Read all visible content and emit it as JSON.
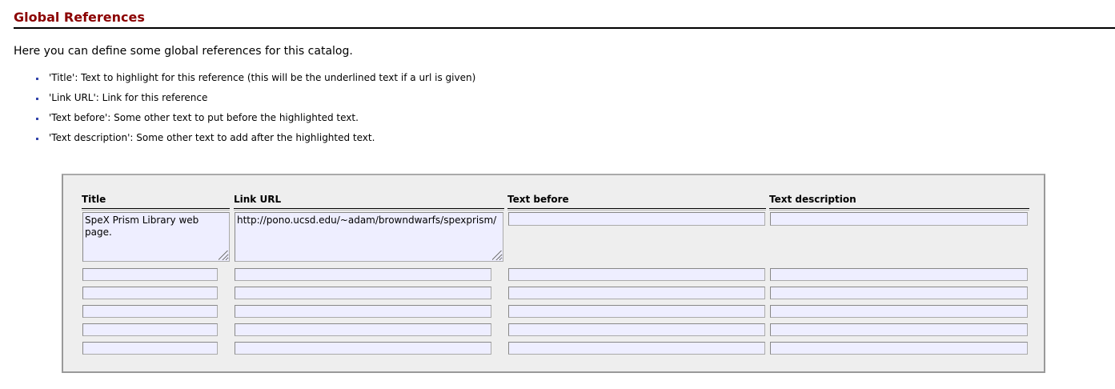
{
  "page": {
    "title": "Global References",
    "intro": "Here you can define some global references for this catalog."
  },
  "help_items": [
    "'Title': Text to highlight for this reference (this will be the underlined text if a url is given)",
    "'Link URL': Link for this reference",
    "'Text before': Some other text to put before the highlighted text.",
    "'Text description': Some other text to add after the highlighted text."
  ],
  "columns": {
    "title": "Title",
    "link_url": "Link URL",
    "text_before": "Text before",
    "text_description": "Text description"
  },
  "rows": [
    {
      "title": "SpeX Prism Library web page.",
      "link_url": "http://pono.ucsd.edu/~adam/browndwarfs/spexprism/",
      "text_before": "",
      "text_description": ""
    },
    {
      "title": "",
      "link_url": "",
      "text_before": "",
      "text_description": ""
    },
    {
      "title": "",
      "link_url": "",
      "text_before": "",
      "text_description": ""
    },
    {
      "title": "",
      "link_url": "",
      "text_before": "",
      "text_description": ""
    },
    {
      "title": "",
      "link_url": "",
      "text_before": "",
      "text_description": ""
    },
    {
      "title": "",
      "link_url": "",
      "text_before": "",
      "text_description": ""
    }
  ],
  "colors": {
    "title": "#8b0000",
    "bullet": "#3344aa",
    "field_bg": "#eeeeff",
    "panel_bg": "#eeeeee"
  }
}
